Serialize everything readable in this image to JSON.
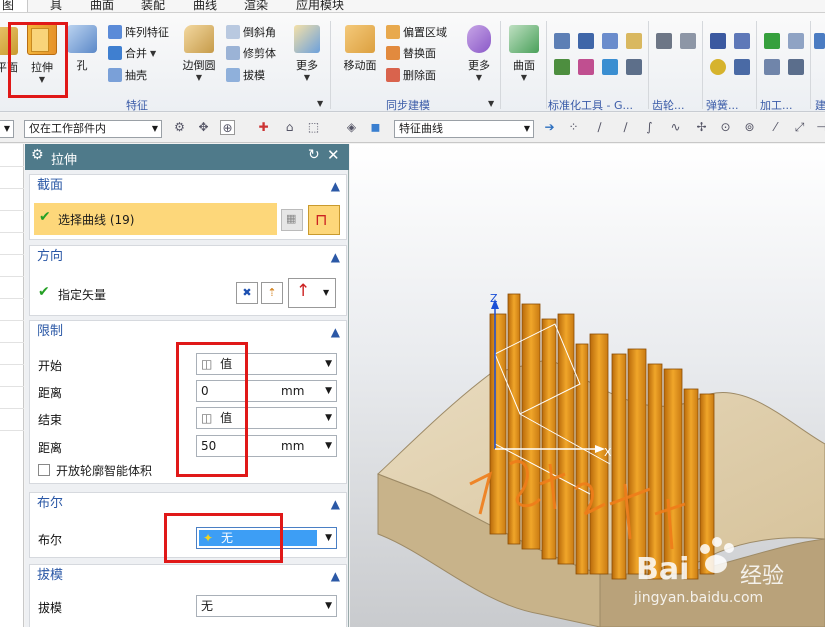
{
  "menubar": {
    "items": [
      "图",
      "具",
      "曲面",
      "装配",
      "曲线",
      "渲染",
      "应用模块"
    ]
  },
  "ribbon": {
    "plane_label": "平面",
    "extrude_label": "拉伸",
    "hole_label": "孔",
    "array_label": "阵列特征",
    "merge_label": "合并",
    "shell_label": "抽壳",
    "edge_blend_label": "边倒圆",
    "chamfer_label": "倒斜角",
    "trim_body_label": "修剪体",
    "draft_label": "拔模",
    "more1_label": "更多",
    "feature_group": "特征",
    "move_face_label": "移动面",
    "offset_region_label": "偏置区域",
    "replace_face_label": "替换面",
    "delete_face_label": "删除面",
    "more2_label": "更多",
    "sync_group": "同步建模",
    "surface_label": "曲面",
    "std_tools_group": "标准化工具 - G...",
    "gear_group": "齿轮...",
    "spring_group": "弹簧...",
    "machining_group": "加工...",
    "build_group": "建"
  },
  "toolbar": {
    "filter_label": "仅在工作部件内",
    "curve_rule": "特征曲线"
  },
  "dialog": {
    "title": "拉伸",
    "section": {
      "title": "截面",
      "select_curve": "选择曲线 (19)"
    },
    "direction": {
      "title": "方向",
      "specify_vector": "指定矢量"
    },
    "limits": {
      "title": "限制",
      "start_label": "开始",
      "start_value": "值",
      "distance1_label": "距离",
      "distance1_value": "0",
      "distance1_unit": "mm",
      "end_label": "结束",
      "end_value": "值",
      "distance2_label": "距离",
      "distance2_value": "50",
      "distance2_unit": "mm",
      "open_profile_label": "开放轮廓智能体积"
    },
    "boolean": {
      "title": "布尔",
      "label": "布尔",
      "value": "无"
    },
    "draft": {
      "title": "拔模",
      "label": "拔模",
      "value": "无"
    }
  },
  "viewport": {
    "axis_z": "Z",
    "axis_x": "X",
    "watermark_brand": "Bai",
    "watermark_sub": "经验",
    "watermark_url": "jingyan.baidu.com"
  },
  "colors": {
    "accent": "#2b58a6",
    "title_bar": "#4f7a8a",
    "selected_row": "#fdd77a",
    "boolean_highlight": "#3d9ef5",
    "highlight_box": "#e01818",
    "solid": "#d58a12"
  }
}
